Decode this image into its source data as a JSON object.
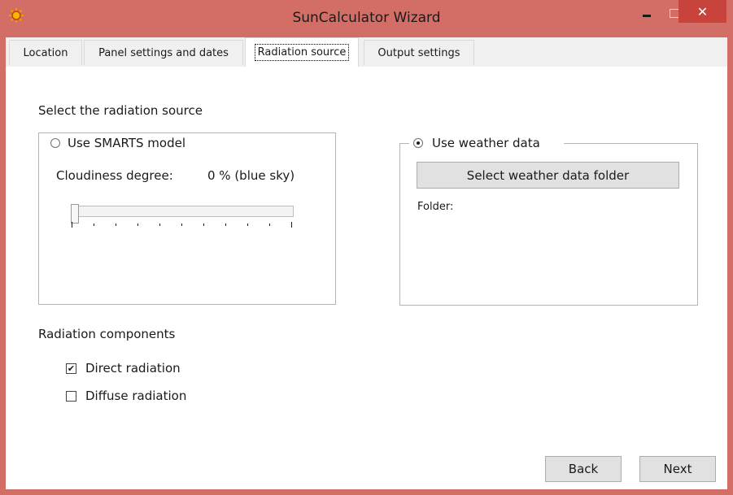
{
  "window": {
    "title": "SunCalculator Wizard",
    "close_glyph": "✕"
  },
  "tabs": [
    {
      "label": "Location"
    },
    {
      "label": "Panel settings and dates"
    },
    {
      "label": "Radiation source"
    },
    {
      "label": "Output settings"
    }
  ],
  "active_tab": "Radiation source",
  "content": {
    "select_heading": "Select the radiation source",
    "smarts": {
      "radio_label": "Use SMARTS model",
      "selected": false,
      "cloudiness_label": "Cloudiness degree:",
      "cloudiness_value": "0 % (blue sky)",
      "slider_value_percent": 0
    },
    "weather": {
      "radio_label": "Use weather data",
      "selected": true,
      "select_button": "Select weather data folder",
      "folder_label": "Folder:"
    },
    "components_heading": "Radiation components",
    "direct": {
      "label": "Direct radiation",
      "checked": true
    },
    "diffuse": {
      "label": "Diffuse radiation",
      "checked": false
    }
  },
  "footer": {
    "back_label": "Back",
    "next_label": "Next"
  },
  "colors": {
    "title_bar": "#d26e66",
    "close_button": "#c7433c"
  }
}
